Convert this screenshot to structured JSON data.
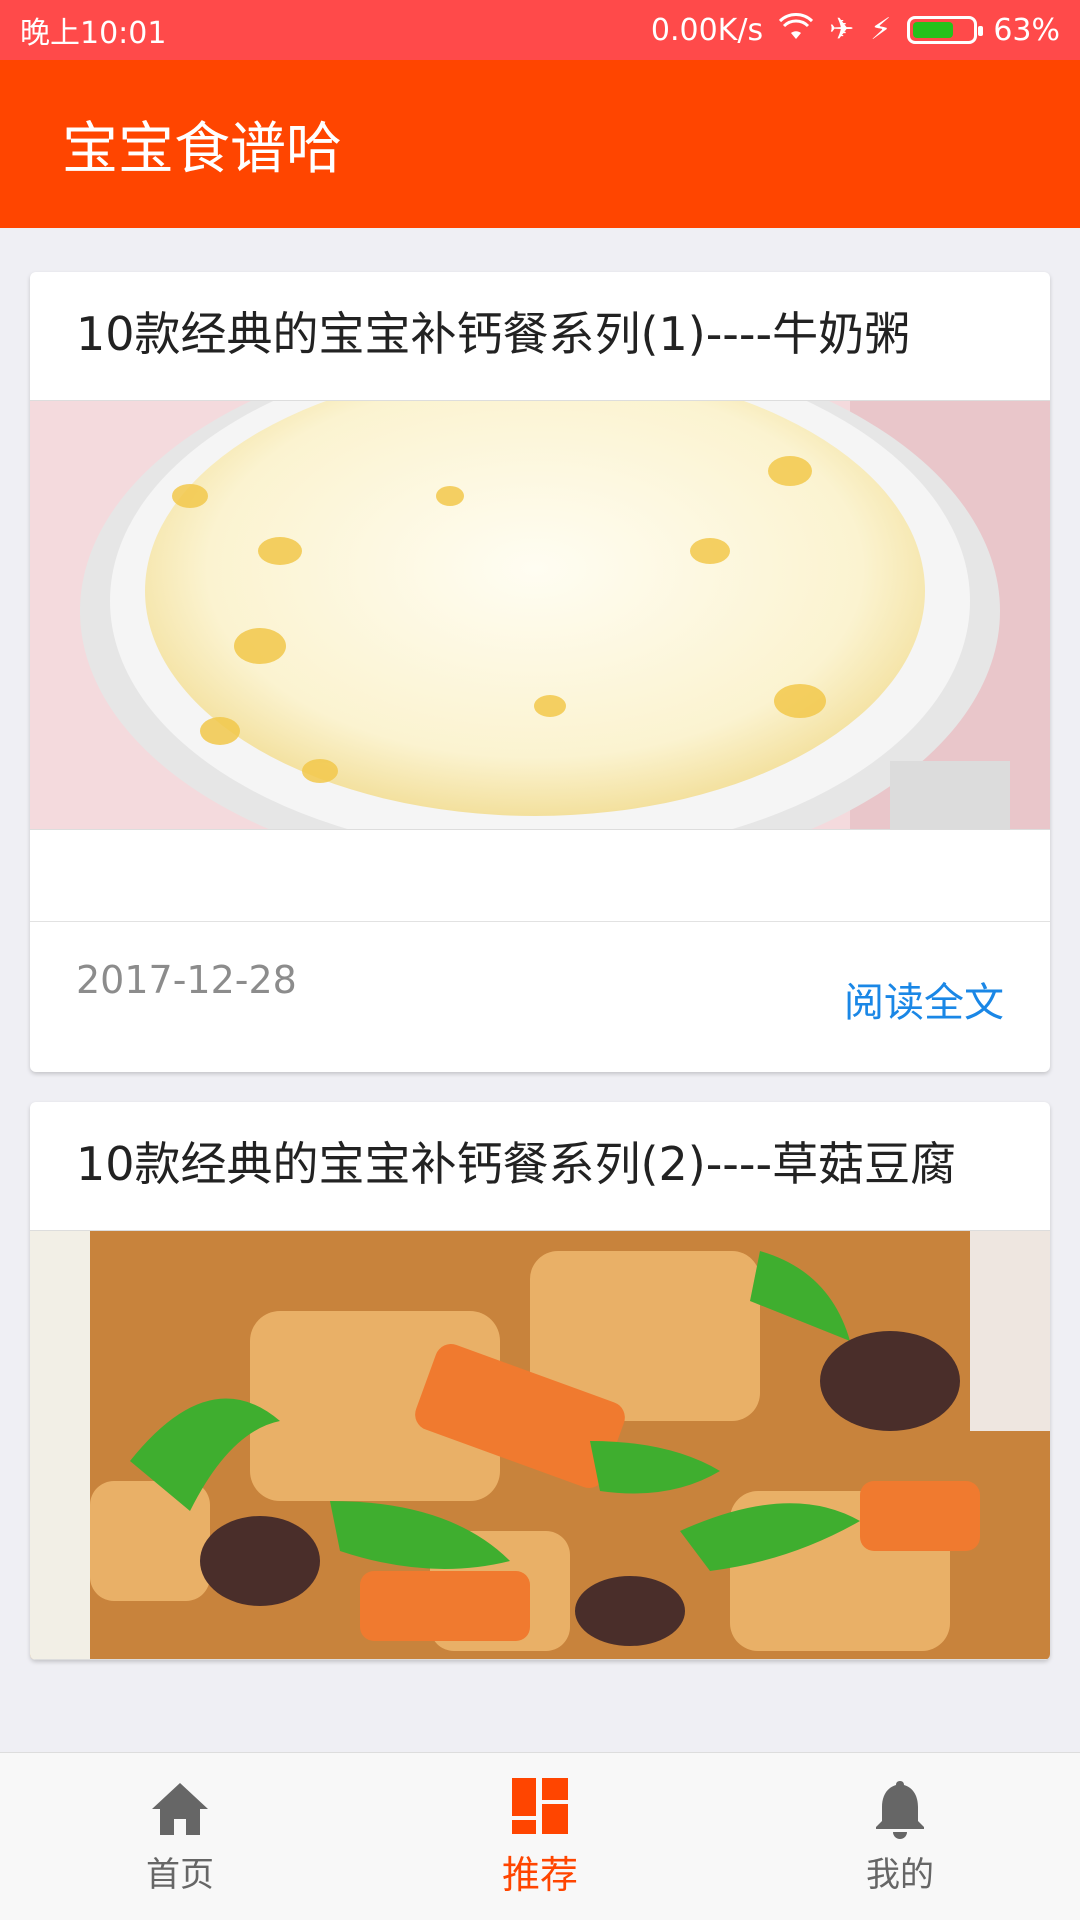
{
  "statusbar": {
    "time": "晚上10:01",
    "network_speed": "0.00K/s",
    "battery_percent": "63%",
    "battery_level": 0.63,
    "icons": [
      "wifi-icon",
      "airplane-icon",
      "charging-icon",
      "battery-icon"
    ]
  },
  "appbar": {
    "title": "宝宝食谱哈"
  },
  "colors": {
    "accent": "#ff4500",
    "statusbar": "#ff4a4a",
    "link": "#1a87e6",
    "date": "#8c8c8c"
  },
  "cards": [
    {
      "title": "10款经典的宝宝补钙餐系列(1)----牛奶粥",
      "image_name": "milk-porridge-image",
      "date": "2017-12-28",
      "read_label": "阅读全文"
    },
    {
      "title": "10款经典的宝宝补钙餐系列(2)----草菇豆腐",
      "image_name": "mushroom-tofu-image"
    }
  ],
  "tabs": [
    {
      "label": "首页",
      "icon": "home-icon",
      "active": false
    },
    {
      "label": "推荐",
      "icon": "grid-icon",
      "active": true
    },
    {
      "label": "我的",
      "icon": "bell-icon",
      "active": false
    }
  ]
}
